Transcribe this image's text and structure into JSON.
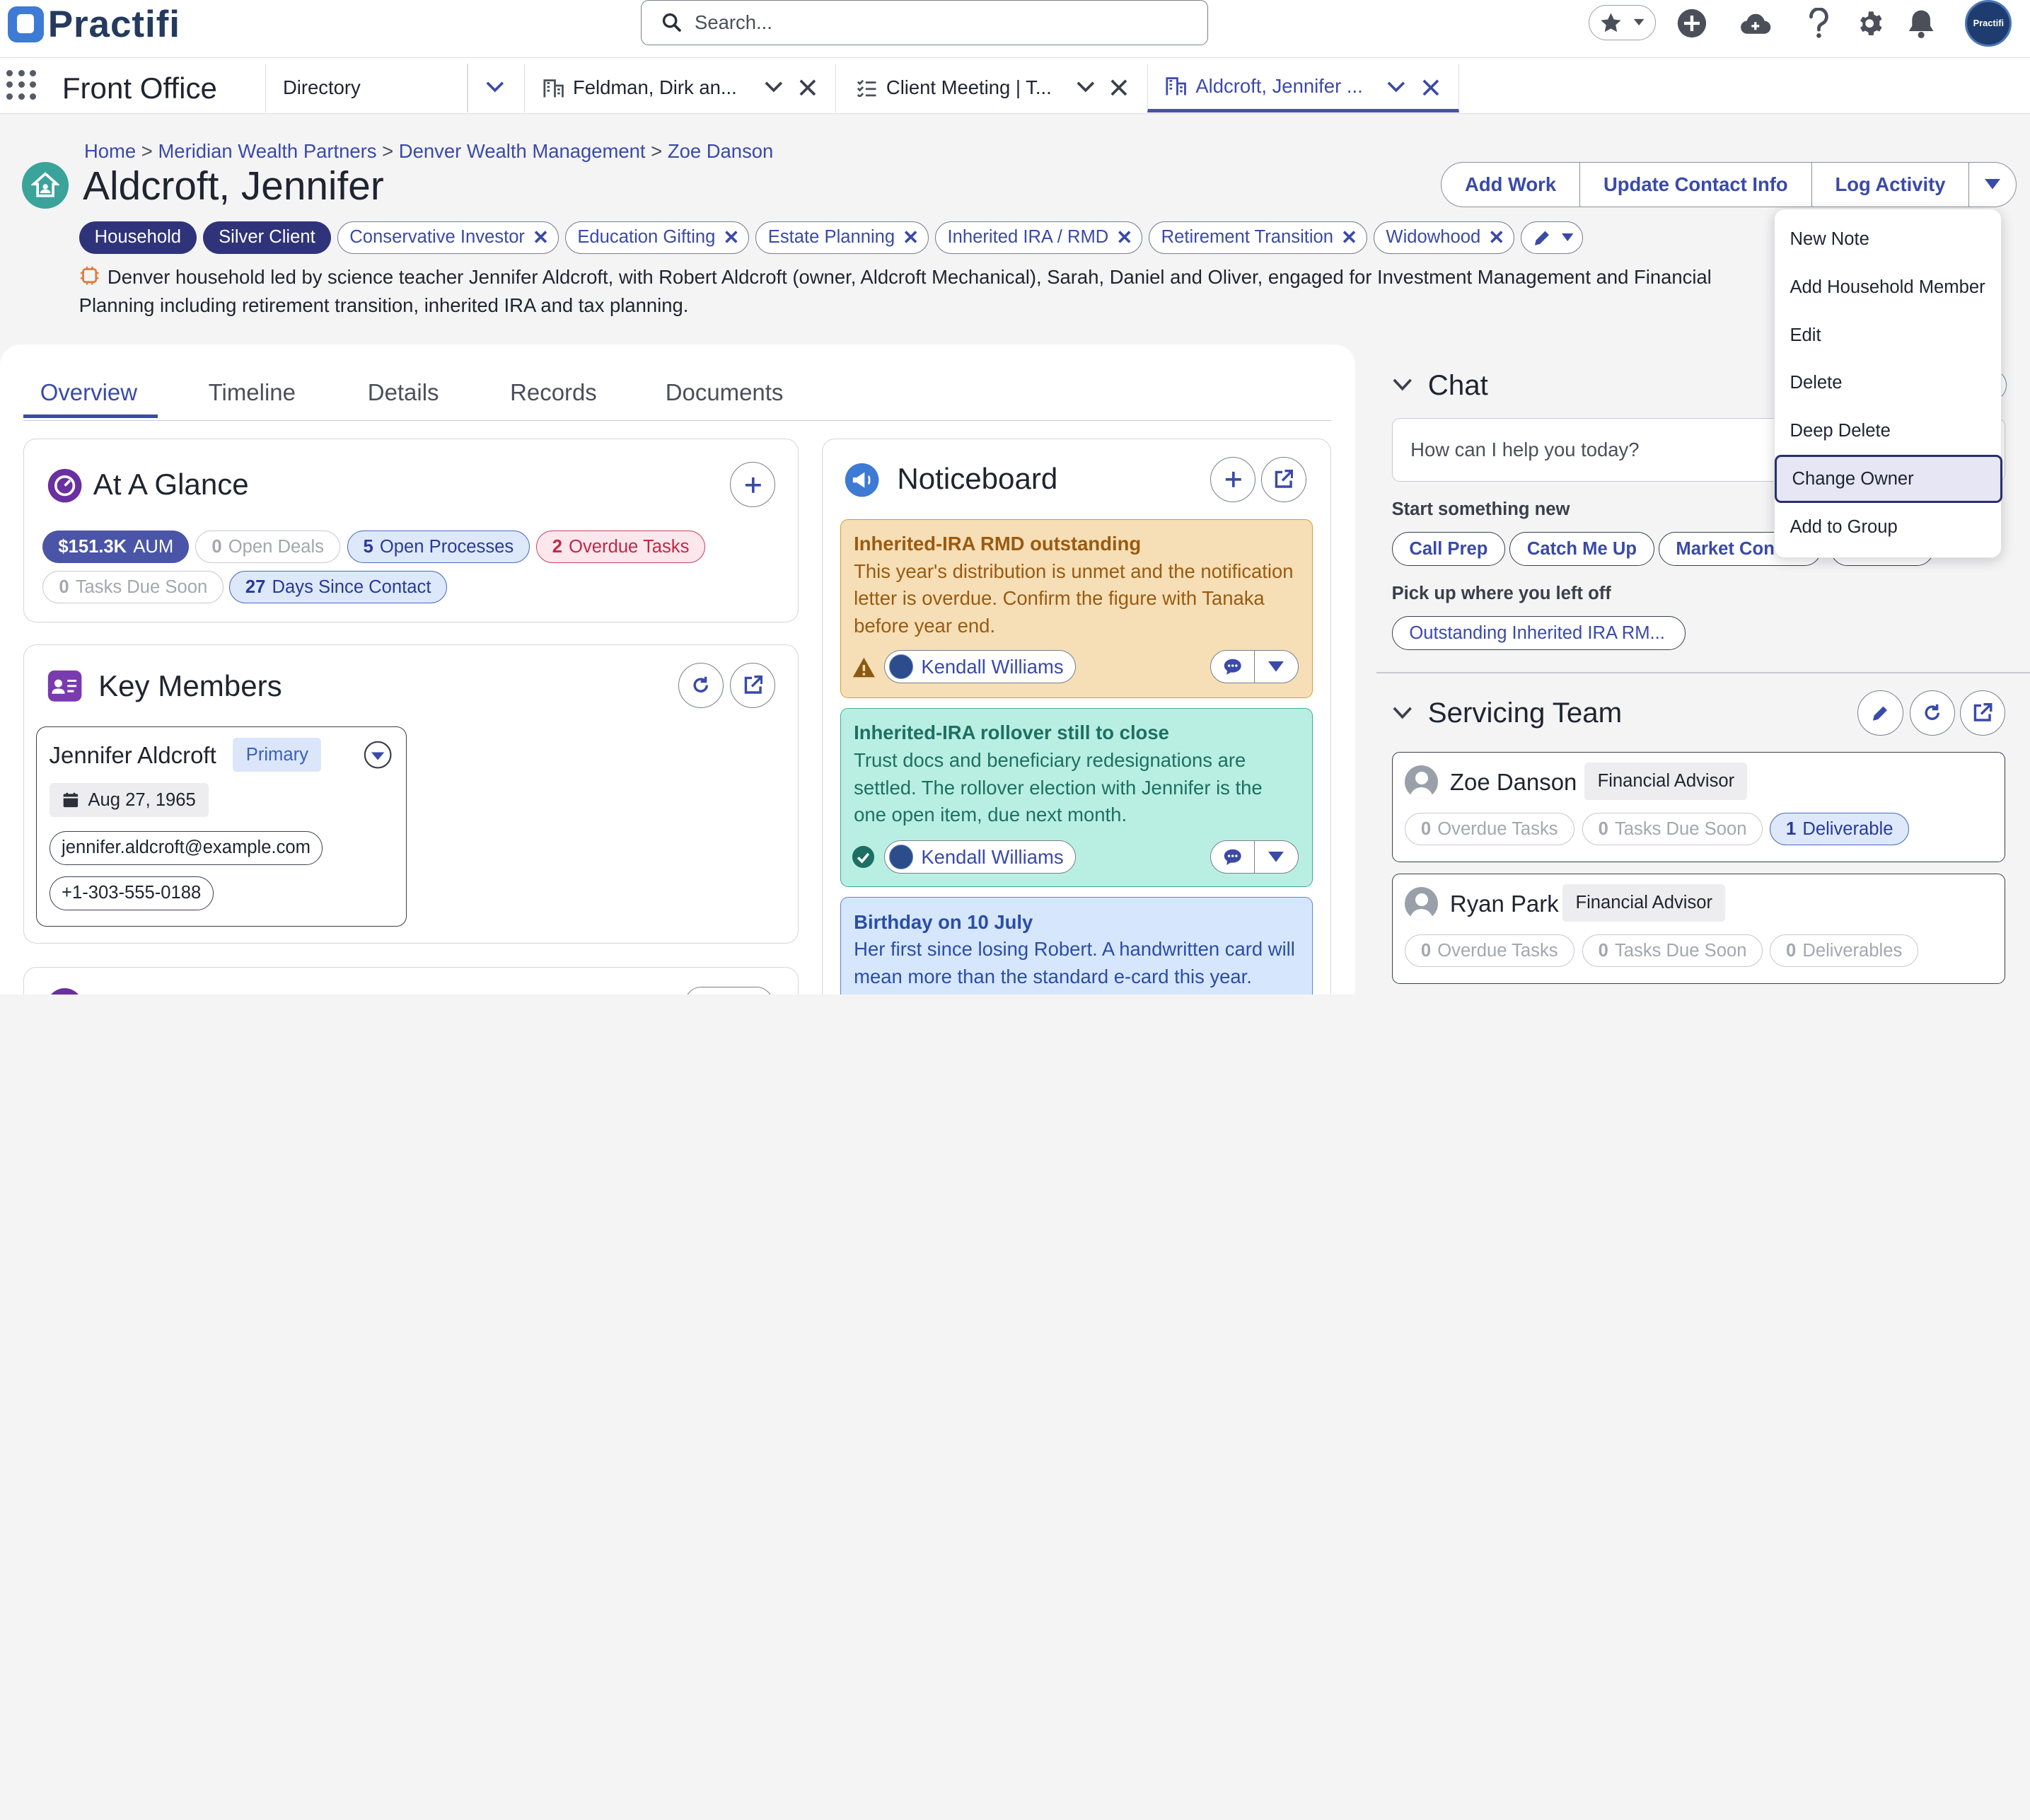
{
  "app": {
    "logo_text": "Practifi",
    "brand_color": "#3d7bd4",
    "accent_color": "#3a4aa8"
  },
  "search": {
    "placeholder": "Search..."
  },
  "top_icons": [
    "star-icon",
    "plus-circle-icon",
    "cloud-icon",
    "help-icon",
    "gear-icon",
    "bell-icon"
  ],
  "user_avatar_text": "Practifi",
  "workspace": {
    "name": "Front Office"
  },
  "tabs": [
    {
      "label": "Directory"
    },
    {
      "label": "Feldman, Dirk an..."
    },
    {
      "label": "Client Meeting | T..."
    },
    {
      "label": "Aldcroft, Jennifer ..."
    }
  ],
  "breadcrumb": [
    "Home",
    "Meridian Wealth Partners",
    "Denver Wealth Management",
    "Zoe Danson"
  ],
  "breadcrumb_sep": ">",
  "record": {
    "title": "Aldcroft, Jennifer",
    "description": "Denver household led by science teacher Jennifer Aldcroft, with Robert Aldcroft (owner, Aldcroft Mechanical), Sarah, Daniel and Oliver, engaged for Investment Management and Financial Planning including retirement transition, inherited IRA and tax planning."
  },
  "actions": {
    "add_work": "Add Work",
    "update_contact": "Update Contact Info",
    "log_activity": "Log Activity"
  },
  "tags": {
    "fixed": [
      "Household",
      "Silver Client"
    ],
    "removable": [
      "Conservative Investor",
      "Education Gifting",
      "Estate Planning",
      "Inherited IRA / RMD",
      "Retirement Transition",
      "Widowhood"
    ]
  },
  "main_tabs": [
    "Overview",
    "Timeline",
    "Details",
    "Records",
    "Documents"
  ],
  "at_a_glance": {
    "title": "At A Glance",
    "aum": {
      "value": "$151.3K",
      "label": "AUM"
    },
    "open_deals": {
      "value": "0",
      "label": "Open Deals"
    },
    "open_processes": {
      "value": "5",
      "label": "Open Processes"
    },
    "overdue_tasks": {
      "value": "2",
      "label": "Overdue Tasks"
    },
    "tasks_due_soon": {
      "value": "0",
      "label": "Tasks Due Soon"
    },
    "days_since_contact": {
      "value": "27",
      "label": "Days Since Contact"
    }
  },
  "key_members": {
    "title": "Key Members",
    "member": {
      "name": "Jennifer Aldcroft",
      "badge": "Primary",
      "dob": "Aug 27, 1965",
      "email": "jennifer.aldcroft@example.com",
      "phone": "+1-303-555-0188"
    }
  },
  "noticeboard": {
    "title": "Noticeboard",
    "notes": [
      {
        "title": "Inherited-IRA RMD outstanding",
        "body": "This year's distribution is unmet and the notification letter is overdue. Confirm the figure with Tanaka before year end.",
        "owner": "Kendall Williams",
        "color": "#f6dfb6"
      },
      {
        "title": "Inherited-IRA rollover still to close",
        "body": "Trust docs and beneficiary redesignations are settled. The rollover election with Jennifer is the one open item, due next month.",
        "owner": "Kendall Williams",
        "color": "#b9efe2"
      },
      {
        "title": "Birthday on 10 July",
        "body": "Her first since losing Robert. A handwritten card will mean more than the standard e-card this year.",
        "color": "#d6e6fc"
      }
    ]
  },
  "chat": {
    "title": "Chat",
    "placeholder": "How can I help you today?",
    "start_label": "Start something new",
    "quick_actions": [
      "Call Prep",
      "Catch Me Up",
      "Market Con"
    ],
    "resume_label": "Pick up where you left off",
    "resume_item": "Outstanding Inherited IRA RM..."
  },
  "servicing_team": {
    "title": "Servicing Team",
    "members": [
      {
        "name": "Zoe Danson",
        "role": "Financial Advisor",
        "overdue": "0",
        "overdue_label": "Overdue Tasks",
        "due_soon": "0",
        "due_soon_label": "Tasks Due Soon",
        "deliverables": "1",
        "deliverables_label": "Deliverable"
      },
      {
        "name": "Ryan Park",
        "role": "Financial Advisor",
        "overdue": "0",
        "overdue_label": "Overdue Tasks",
        "due_soon": "0",
        "due_soon_label": "Tasks Due Soon",
        "deliverables": "0",
        "deliverables_label": "Deliverables"
      }
    ]
  },
  "actions_menu": {
    "items": [
      "New Note",
      "Add Household Member",
      "Edit",
      "Delete",
      "Deep Delete",
      "Change Owner",
      "Add to Group"
    ],
    "highlighted": "Change Owner"
  }
}
